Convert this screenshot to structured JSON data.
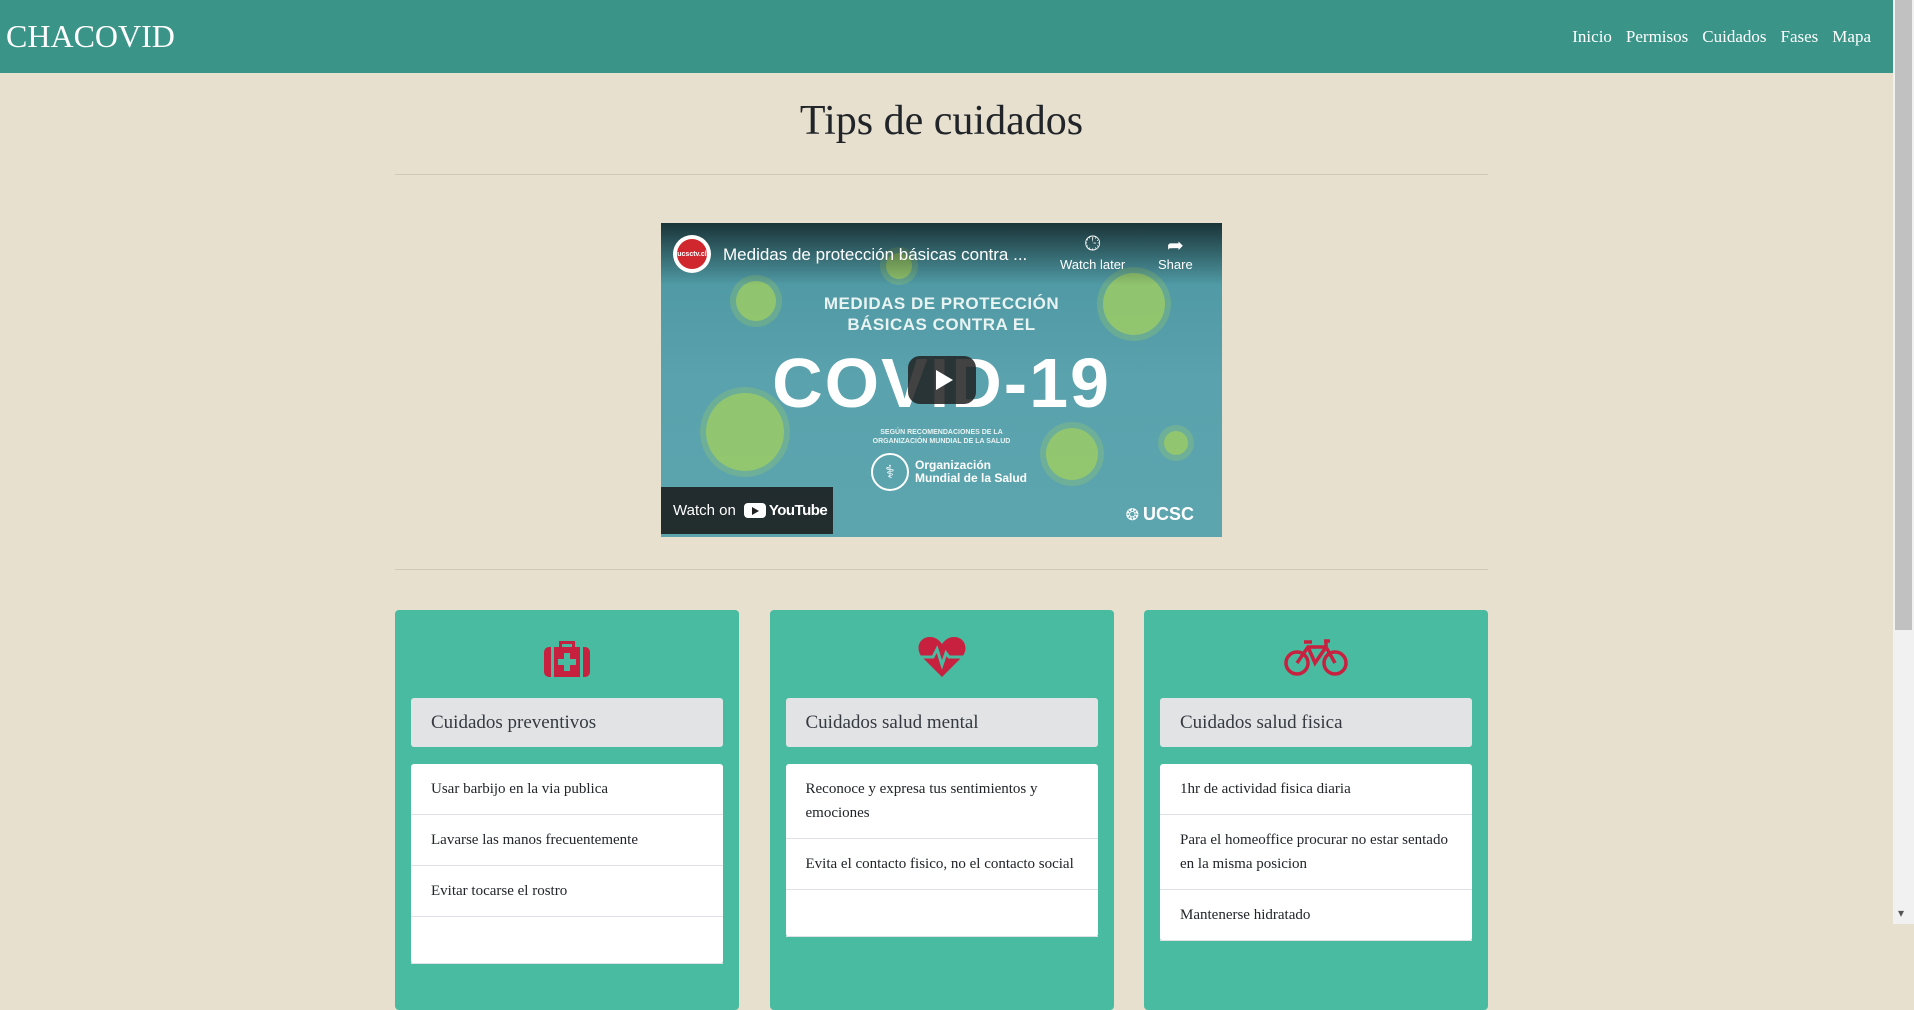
{
  "nav": {
    "brand": "CHACOVID",
    "links": [
      "Inicio",
      "Permisos",
      "Cuidados",
      "Fases",
      "Mapa"
    ]
  },
  "page": {
    "title": "Tips de cuidados"
  },
  "video": {
    "channel_badge": "ucsctv.cl",
    "title": "Medidas de protección básicas contra ...",
    "watch_later": "Watch later",
    "share": "Share",
    "thumb_line1": "MEDIDAS DE PROTECCIÓN",
    "thumb_line2": "BÁSICAS CONTRA EL",
    "thumb_big": "COVID-19",
    "thumb_small": "SEGÚN RECOMENDACIONES DE LA ORGANIZACIÓN MUNDIAL DE LA SALUD",
    "who_line1": "Organización",
    "who_line2": "Mundial de la Salud",
    "watch_on": "Watch on",
    "youtube": "YouTube",
    "ucsc": "UCSC"
  },
  "cards": [
    {
      "icon": "medkit-icon",
      "title": "Cuidados preventivos",
      "items": [
        "Usar barbijo en la via publica",
        "Lavarse las manos frecuentemente",
        "Evitar tocarse el rostro"
      ]
    },
    {
      "icon": "heartbeat-icon",
      "title": "Cuidados salud mental",
      "items": [
        "Reconoce y expresa tus sentimientos y emociones",
        "Evita el contacto fisico, no el contacto social"
      ]
    },
    {
      "icon": "bicycle-icon",
      "title": "Cuidados salud fisica",
      "items": [
        "1hr de actividad fisica diaria",
        "Para el homeoffice procurar no estar sentado en la misma posicion",
        "Mantenerse hidratado"
      ]
    }
  ],
  "colors": {
    "navbar": "#3a9488",
    "background": "#e7e0cf",
    "card": "#48bba1",
    "icon": "#c8203f"
  }
}
